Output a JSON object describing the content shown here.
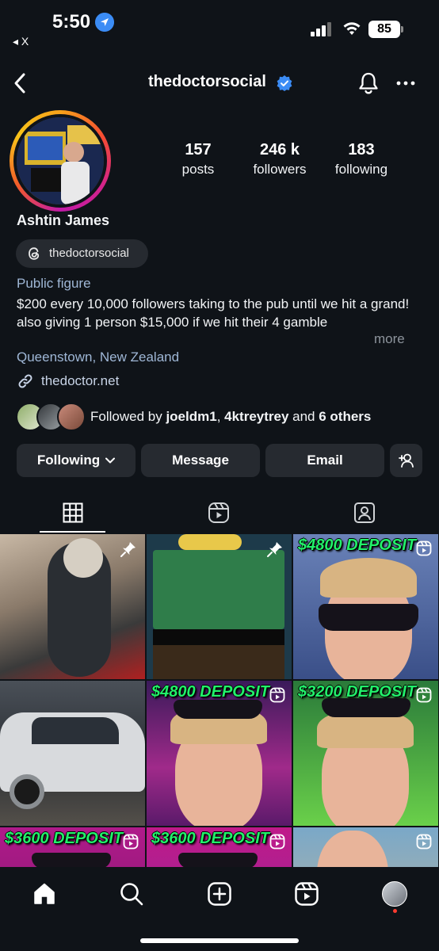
{
  "status_bar": {
    "time": "5:50",
    "back_app": "◂ X",
    "battery": "85"
  },
  "header": {
    "username": "thedoctorsocial"
  },
  "profile": {
    "stats": [
      {
        "value": "157",
        "label": "posts"
      },
      {
        "value": "246 k",
        "label": "followers"
      },
      {
        "value": "183",
        "label": "following"
      }
    ],
    "full_name": "Ashtin James",
    "threads_handle": "thedoctorsocial",
    "category": "Public figure",
    "bio_lines": [
      "$200 every 10,000 followers taking to the pub until we hit a grand!",
      "also giving 1 person $15,000 if we hit their 4 gamble"
    ],
    "more_label": "more",
    "location": "Queenstown, New Zealand",
    "link": "thedoctor.net",
    "followed_by": {
      "prefix": "Followed by ",
      "user1": "joeldm1",
      "separator": ", ",
      "user2": "4ktreytrey",
      "and": " and ",
      "others": "6 others"
    }
  },
  "actions": {
    "following": "Following",
    "message": "Message",
    "email": "Email"
  },
  "grid": {
    "captions": [
      "",
      "",
      "$4800 DEPOSIT",
      "",
      "$4800 DEPOSIT",
      "$3200 DEPOSIT",
      "$3600 DEPOSIT",
      "$3600 DEPOSIT",
      ""
    ]
  },
  "colors": {
    "background": "#0f1318",
    "button": "#262a30",
    "link": "#9fb7d6",
    "verified": "#3b8cf5",
    "caption_green": "#22f06a"
  }
}
